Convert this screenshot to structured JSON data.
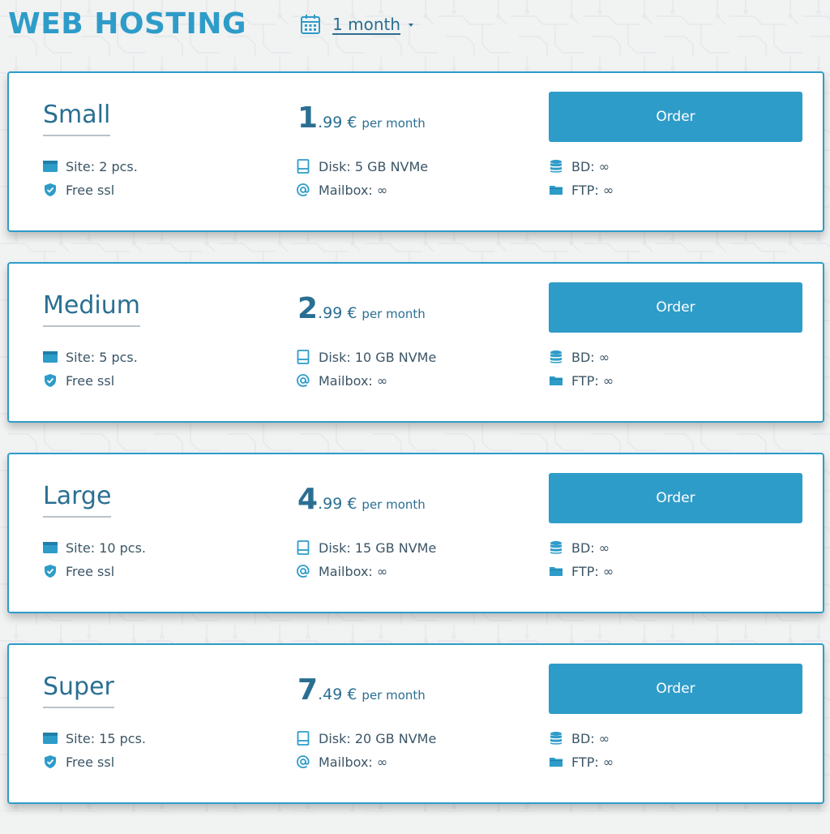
{
  "header": {
    "title": "WEB HOSTING",
    "period_label": "1 month"
  },
  "colors": {
    "accent": "#2e9cc9",
    "text_dark": "#2a6f92",
    "feature_text": "#3b5566",
    "background": "#f1f2f2"
  },
  "plans": [
    {
      "name": "Small",
      "price_int": "1",
      "price_dec": ".99 €",
      "price_unit": "per month",
      "order_label": "Order",
      "site": "Site: 2 pcs.",
      "ssl": "Free ssl",
      "disk": "Disk: 5 GB NVMe",
      "mailbox": "Mailbox: ∞",
      "bd": "BD: ∞",
      "ftp": "FTP: ∞"
    },
    {
      "name": "Medium",
      "price_int": "2",
      "price_dec": ".99 €",
      "price_unit": "per month",
      "order_label": "Order",
      "site": "Site: 5 pcs.",
      "ssl": "Free ssl",
      "disk": "Disk: 10 GB NVMe",
      "mailbox": "Mailbox: ∞",
      "bd": "BD: ∞",
      "ftp": "FTP: ∞"
    },
    {
      "name": "Large",
      "price_int": "4",
      "price_dec": ".99 €",
      "price_unit": "per month",
      "order_label": "Order",
      "site": "Site: 10 pcs.",
      "ssl": "Free ssl",
      "disk": "Disk: 15 GB NVMe",
      "mailbox": "Mailbox: ∞",
      "bd": "BD: ∞",
      "ftp": "FTP: ∞"
    },
    {
      "name": "Super",
      "price_int": "7",
      "price_dec": ".49 €",
      "price_unit": "per month",
      "order_label": "Order",
      "site": "Site: 15 pcs.",
      "ssl": "Free ssl",
      "disk": "Disk: 20 GB NVMe",
      "mailbox": "Mailbox: ∞",
      "bd": "BD: ∞",
      "ftp": "FTP: ∞"
    }
  ],
  "icons": {
    "period": "calendar-icon",
    "period_caret": "caret-down-icon",
    "site": "browser-window-icon",
    "ssl": "shield-check-icon",
    "disk": "hard-drive-icon",
    "mailbox": "at-sign-icon",
    "bd": "database-icon",
    "ftp": "folder-icon"
  }
}
